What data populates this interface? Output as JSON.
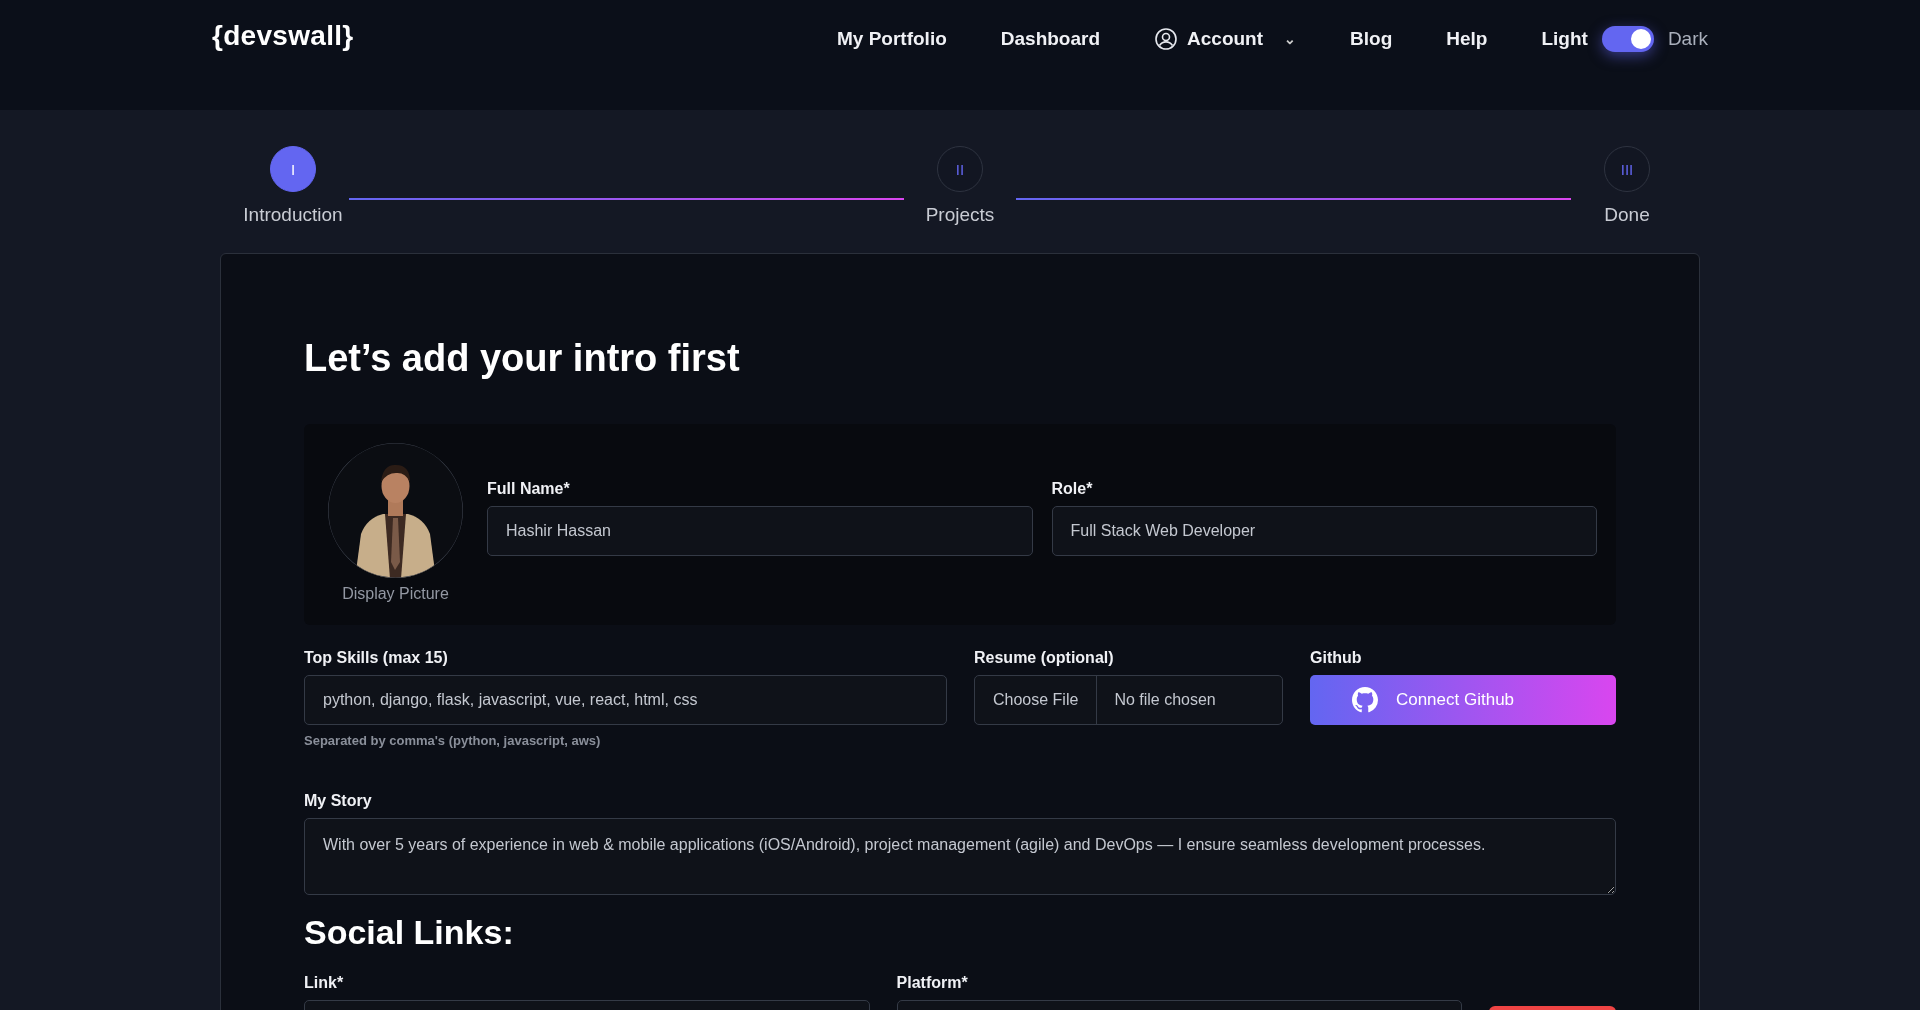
{
  "header": {
    "logo": "{devswall}",
    "nav": [
      "My Portfolio",
      "Dashboard"
    ],
    "account": {
      "label": "Account",
      "caret": "⌄"
    },
    "nav_after": [
      "Blog",
      "Help"
    ],
    "theme_toggle": {
      "left_label": "Light",
      "right_label": "Dark",
      "on": true
    }
  },
  "stepper": [
    {
      "numeral": "I",
      "label": "Introduction",
      "selected": true
    },
    {
      "numeral": "II",
      "label": "Projects",
      "selected": false
    },
    {
      "numeral": "III",
      "label": "Done",
      "selected": false
    }
  ],
  "form": {
    "title": "Let’s add your intro first",
    "avatar": {
      "kind": "picture",
      "caption": "Display Picture"
    },
    "full_name": {
      "label": "Full Name*",
      "value": "Hashir Hassan"
    },
    "role": {
      "label": "Role*",
      "value": "Full Stack Web Developer"
    },
    "skills": {
      "label": "Top Skills (max 15)",
      "value": "python, django, flask, javascript, vue, react, html, css",
      "hint": "Separated by comma's (python, javascript, aws)"
    },
    "resume": {
      "label": "Resume (optional)",
      "button": "Choose File",
      "status": "No file chosen"
    },
    "github": {
      "label": "Github",
      "button": "Connect Github"
    },
    "story": {
      "label": "My Story",
      "value": "With over 5 years of experience in web & mobile applications (iOS/Android), project management (agile) and DevOps — I ensure seamless development processes."
    },
    "social": {
      "title": "Social Links:",
      "link_label": "Link*",
      "platform_label": "Platform*"
    }
  }
}
